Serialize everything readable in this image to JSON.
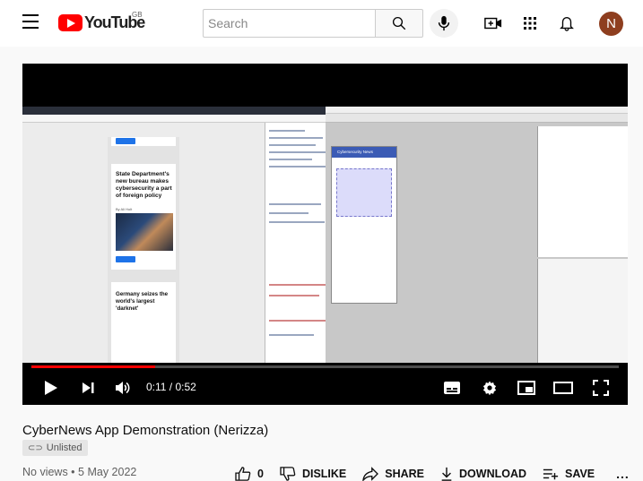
{
  "header": {
    "logo_text": "YouTube",
    "region": "GB",
    "search_placeholder": "Search",
    "avatar_initial": "N"
  },
  "player": {
    "current_time": "0:11",
    "duration": "0:52",
    "time_display": "0:11 / 0:52",
    "progress_fraction": 0.21,
    "screen": {
      "article_1": "State Department's new bureau makes cybersecurity a part of foreign policy",
      "article_1_byline": "By Ali Holt",
      "article_2": "Germany seizes the world's largest 'darknet'",
      "app_header": "Cybersecurity News"
    }
  },
  "video": {
    "title": "CyberNews App Demonstration (Nerizza)",
    "visibility": "Unlisted",
    "meta": "No views • 5 May 2022"
  },
  "actions": {
    "like_count": "0",
    "dislike": "DISLIKE",
    "share": "SHARE",
    "download": "DOWNLOAD",
    "save": "SAVE",
    "more": "..."
  },
  "colors": {
    "brand_red": "#ff0000",
    "progress_red": "#ff0000",
    "avatar_bg": "#8e3e1f"
  }
}
